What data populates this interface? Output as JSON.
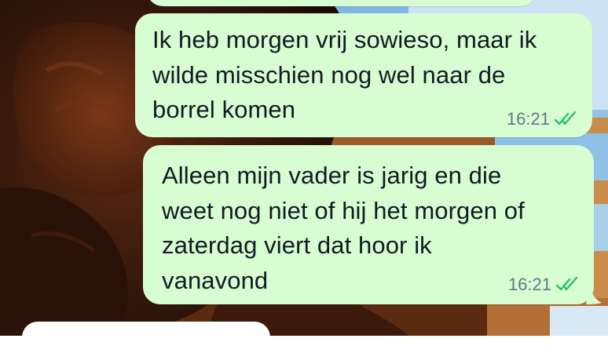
{
  "chat": {
    "messages": [
      {
        "text": "Ik heb morgen vrij sowieso, maar ik\nwilde misschien nog wel naar de\nborrel komen",
        "time": "16:21",
        "status": "read",
        "status_icon": "double-check-icon",
        "direction": "outgoing"
      },
      {
        "text": "Alleen mijn vader is jarig en die\nweet nog niet of hij het morgen of\nzaterdag viert dat hoor ik\nvanavond",
        "time": "16:21",
        "status": "read",
        "status_icon": "double-check-icon",
        "direction": "outgoing"
      }
    ]
  },
  "colors": {
    "outgoing_bubble": "#d9fdd3",
    "read_tick": "#25c26e",
    "timestamp": "#667781",
    "incoming_bubble": "#ffffff"
  }
}
